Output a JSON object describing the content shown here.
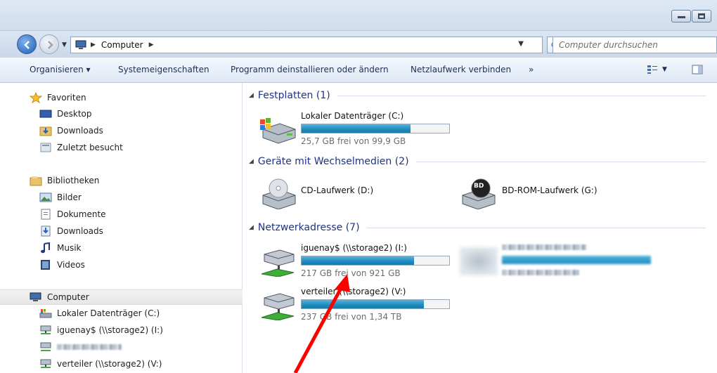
{
  "address": {
    "crumbs": [
      "Computer"
    ],
    "search_placeholder": "Computer durchsuchen"
  },
  "toolbar": {
    "organize": "Organisieren ▾",
    "system_properties": "Systemeigenschaften",
    "uninstall": "Programm deinstallieren oder ändern",
    "map_drive": "Netzlaufwerk verbinden",
    "more": "»"
  },
  "navpane": {
    "favorites_header": "Favoriten",
    "favorites": [
      "Desktop",
      "Downloads",
      "Zuletzt besucht"
    ],
    "libraries_header": "Bibliotheken",
    "libraries": [
      "Bilder",
      "Dokumente",
      "Downloads",
      "Musik",
      "Videos"
    ],
    "computer_header": "Computer",
    "computer_items": [
      "Lokaler Datenträger (C:)",
      "iguenay$ (\\\\storage2) (I:)",
      "",
      "verteiler (\\\\storage2) (V:)"
    ]
  },
  "groups": {
    "hard_disks": "Festplatten (1)",
    "removable": "Geräte mit Wechselmedien (2)",
    "network": "Netzwerkadresse (7)"
  },
  "drives": {
    "c": {
      "name": "Lokaler Datenträger (C:)",
      "free": "25,7 GB frei von 99,9 GB",
      "used_fraction": 0.74
    },
    "d": {
      "name": "CD-Laufwerk (D:)"
    },
    "g": {
      "name": "BD-ROM-Laufwerk (G:)",
      "badge": "BD"
    },
    "i": {
      "name": "iguenay$ (\\\\storage2) (I:)",
      "free": "217 GB frei von 921 GB",
      "used_fraction": 0.76
    },
    "v": {
      "name": "verteiler (\\\\storage2) (V:)",
      "free": "237 GB frei von 1,34 TB",
      "used_fraction": 0.83
    }
  },
  "colors": {
    "annotation_arrow": "#ff0000",
    "group_header": "#1e3287",
    "bar_fill": "#1f8bbd"
  }
}
